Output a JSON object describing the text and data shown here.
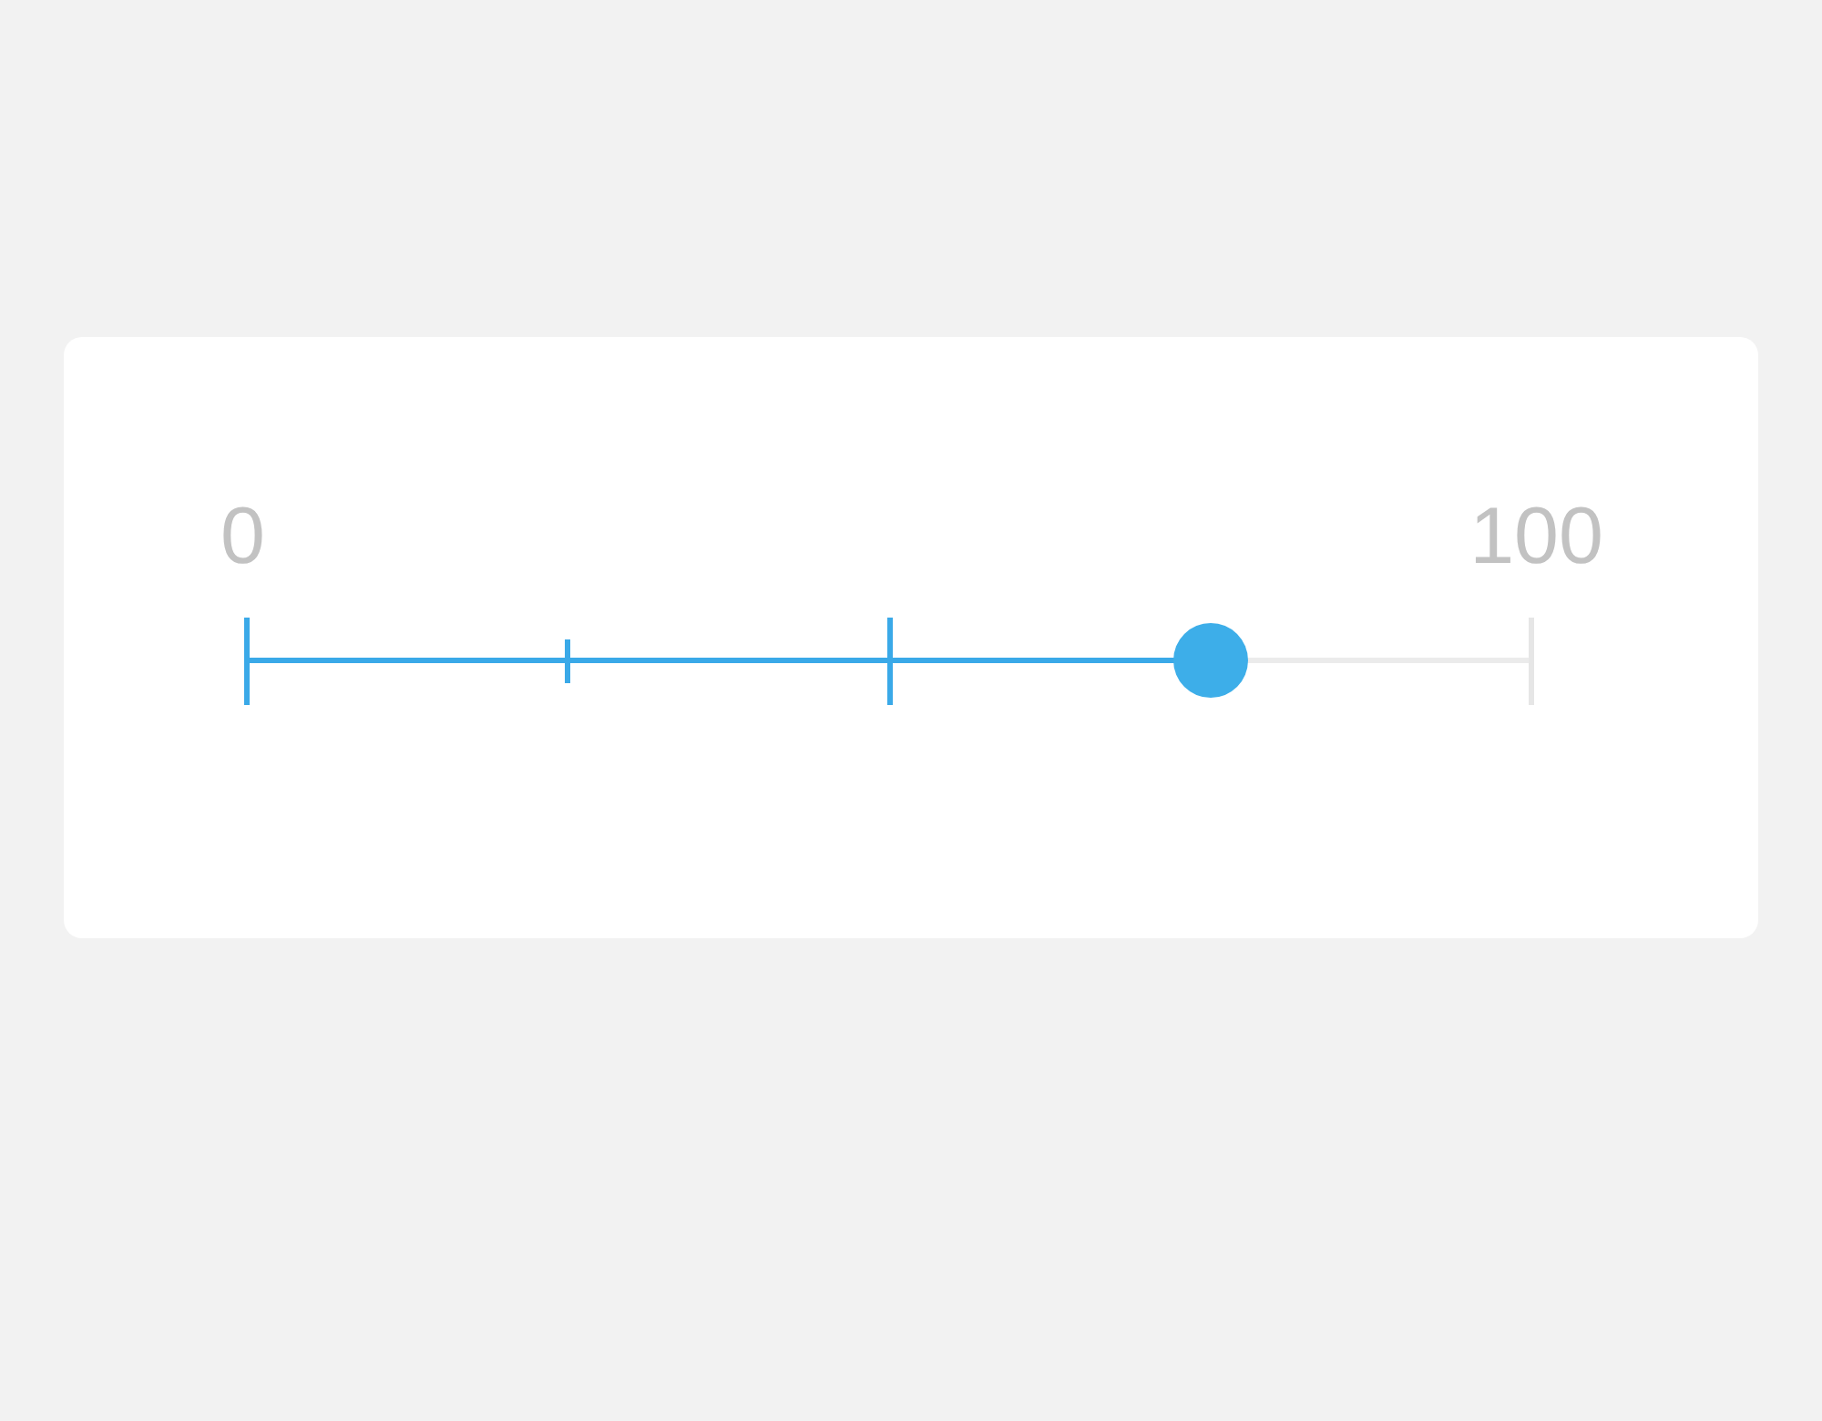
{
  "slider": {
    "min_label": "0",
    "max_label": "100",
    "level": 0.75
  }
}
